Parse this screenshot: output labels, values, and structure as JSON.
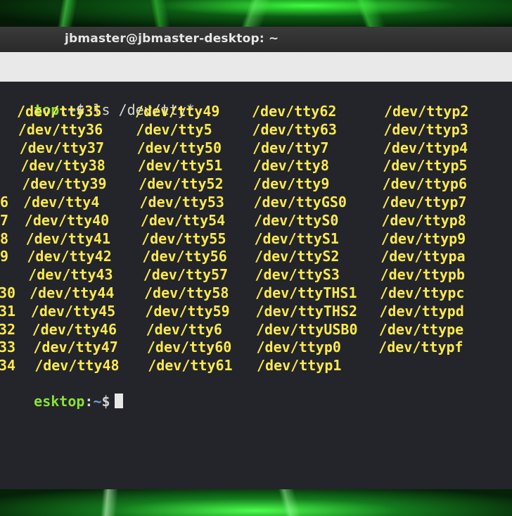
{
  "window": {
    "title": "jbmaster@jbmaster-desktop: ~"
  },
  "terminal": {
    "command_prompt": {
      "host": "top",
      "path": "~",
      "sign": "$",
      "command": " ls /dev/tty*"
    },
    "end_prompt": {
      "host": "esktop",
      "path": "~",
      "sign": "$"
    },
    "left_stubs": [
      "",
      "",
      "",
      "",
      "",
      "6",
      "7",
      "8",
      "9",
      "",
      "30",
      "31",
      "32",
      "33",
      "34"
    ],
    "columns": [
      [
        "/dev/tty35",
        "/dev/tty36",
        "/dev/tty37",
        "/dev/tty38",
        "/dev/tty39",
        "/dev/tty4",
        "/dev/tty40",
        "/dev/tty41",
        "/dev/tty42",
        "/dev/tty43",
        "/dev/tty44",
        "/dev/tty45",
        "/dev/tty46",
        "/dev/tty47",
        "/dev/tty48"
      ],
      [
        "/dev/tty49",
        "/dev/tty5",
        "/dev/tty50",
        "/dev/tty51",
        "/dev/tty52",
        "/dev/tty53",
        "/dev/tty54",
        "/dev/tty55",
        "/dev/tty56",
        "/dev/tty57",
        "/dev/tty58",
        "/dev/tty59",
        "/dev/tty6",
        "/dev/tty60",
        "/dev/tty61"
      ],
      [
        "/dev/tty62",
        "/dev/tty63",
        "/dev/tty7",
        "/dev/tty8",
        "/dev/tty9",
        "/dev/ttyGS0",
        "/dev/ttyS0",
        "/dev/ttyS1",
        "/dev/ttyS2",
        "/dev/ttyS3",
        "/dev/ttyTHS1",
        "/dev/ttyTHS2",
        "/dev/ttyUSB0",
        "/dev/ttyp0",
        "/dev/ttyp1"
      ],
      [
        "/dev/ttyp2",
        "/dev/ttyp3",
        "/dev/ttyp4",
        "/dev/ttyp5",
        "/dev/ttyp6",
        "/dev/ttyp7",
        "/dev/ttyp8",
        "/dev/ttyp9",
        "/dev/ttypa",
        "/dev/ttypb",
        "/dev/ttypc",
        "/dev/ttypd",
        "/dev/ttype",
        "/dev/ttypf"
      ]
    ],
    "colors": {
      "entry": "#fce94f",
      "host": "#8ae234",
      "path": "#729fcf"
    }
  }
}
